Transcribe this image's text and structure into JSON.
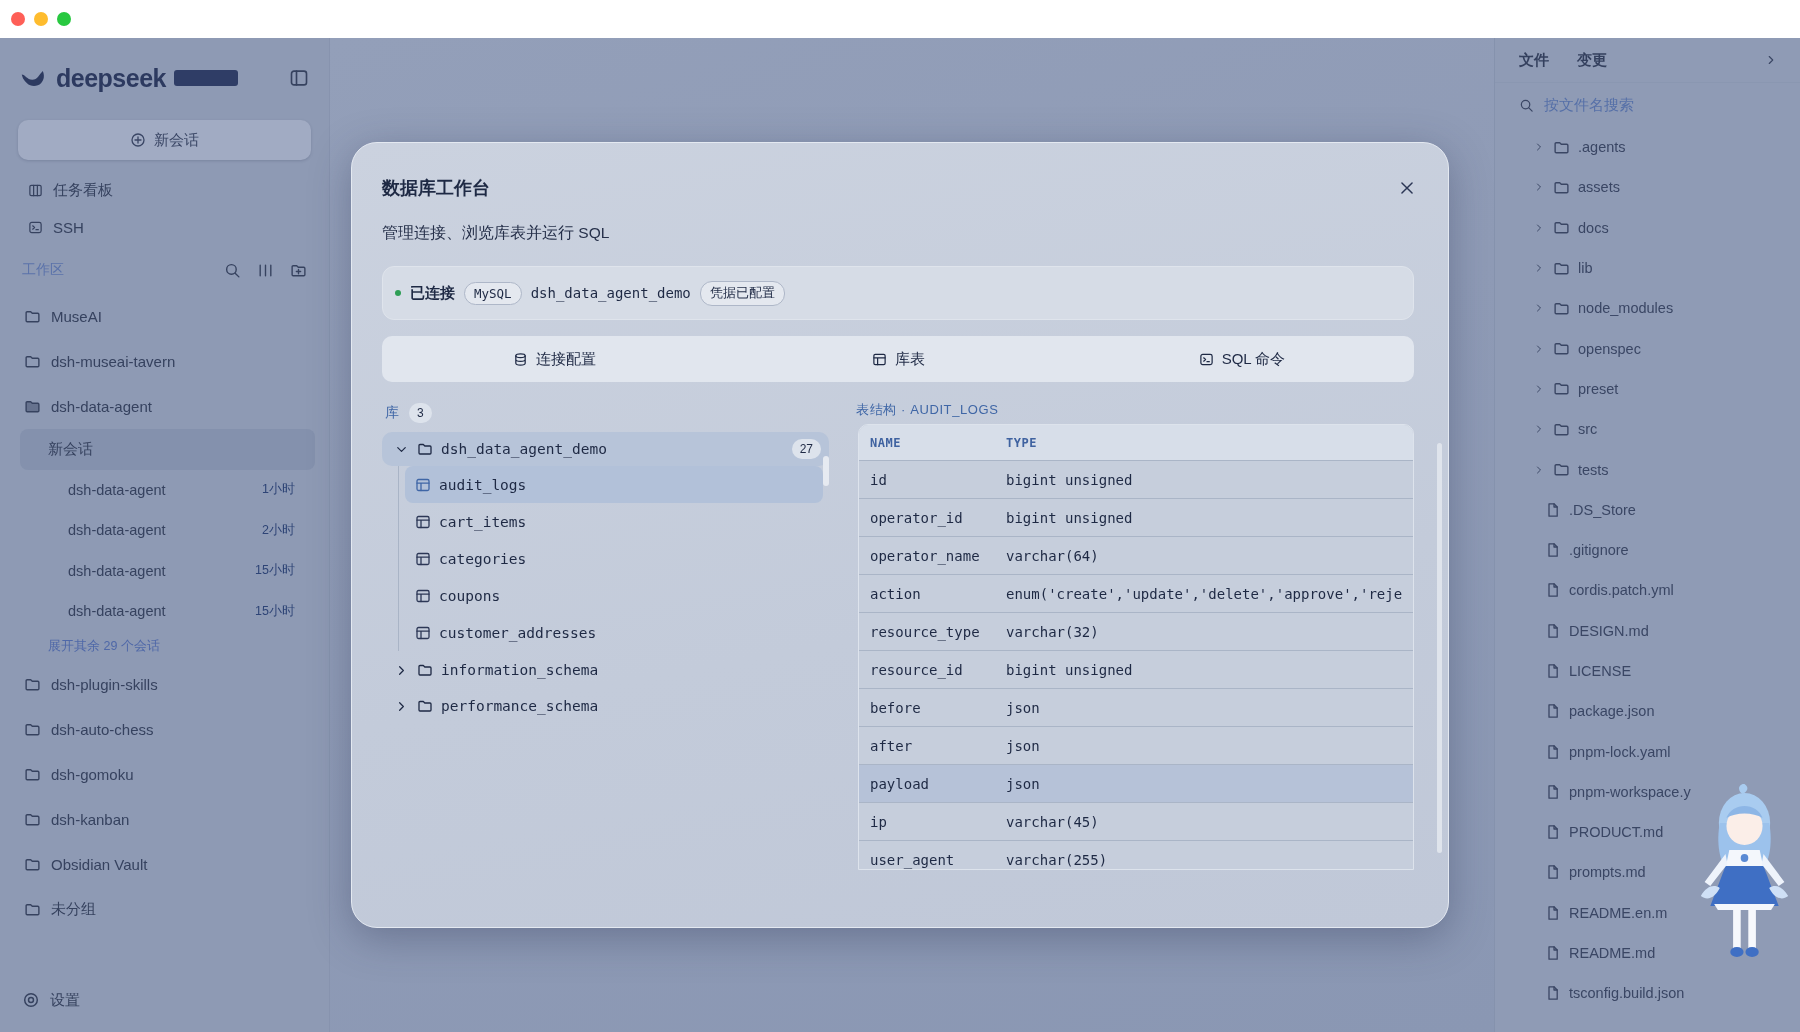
{
  "sidebar": {
    "brand": "deepseek",
    "new_chat": "新会话",
    "nav": [
      {
        "label": "任务看板",
        "kind": "board"
      },
      {
        "label": "SSH",
        "kind": "terminal"
      }
    ],
    "workspace_title": "工作区",
    "workspaces": [
      {
        "label": "MuseAI",
        "expanded": false
      },
      {
        "label": "dsh-museai-tavern",
        "expanded": false
      },
      {
        "label": "dsh-data-agent",
        "expanded": true,
        "children": [
          {
            "label": "新会话",
            "selected": true
          },
          {
            "label": "dsh-data-agent",
            "time": "1小时",
            "selected": false
          },
          {
            "label": "dsh-data-agent",
            "time": "2小时",
            "selected": false
          },
          {
            "label": "dsh-data-agent",
            "time": "15小时",
            "selected": false
          },
          {
            "label": "dsh-data-agent",
            "time": "15小时",
            "selected": false
          }
        ],
        "more": "展开其余 29 个会话"
      },
      {
        "label": "dsh-plugin-skills",
        "expanded": false
      },
      {
        "label": "dsh-auto-chess",
        "expanded": false
      },
      {
        "label": "dsh-gomoku",
        "expanded": false
      },
      {
        "label": "dsh-kanban",
        "expanded": false
      },
      {
        "label": "Obsidian Vault",
        "expanded": false
      },
      {
        "label": "未分组",
        "expanded": false
      }
    ],
    "settings": "设置"
  },
  "file_panel": {
    "tabs": [
      "文件",
      "变更"
    ],
    "search": {
      "placeholder": "按文件名搜索"
    },
    "items": [
      {
        "name": ".agents",
        "kind": "folder"
      },
      {
        "name": "assets",
        "kind": "folder"
      },
      {
        "name": "docs",
        "kind": "folder"
      },
      {
        "name": "lib",
        "kind": "folder"
      },
      {
        "name": "node_modules",
        "kind": "folder"
      },
      {
        "name": "openspec",
        "kind": "folder"
      },
      {
        "name": "preset",
        "kind": "folder"
      },
      {
        "name": "src",
        "kind": "folder"
      },
      {
        "name": "tests",
        "kind": "folder"
      },
      {
        "name": ".DS_Store",
        "kind": "file"
      },
      {
        "name": ".gitignore",
        "kind": "file"
      },
      {
        "name": "cordis.patch.yml",
        "kind": "file"
      },
      {
        "name": "DESIGN.md",
        "kind": "file"
      },
      {
        "name": "LICENSE",
        "kind": "file"
      },
      {
        "name": "package.json",
        "kind": "file"
      },
      {
        "name": "pnpm-lock.yaml",
        "kind": "file"
      },
      {
        "name": "pnpm-workspace.y",
        "kind": "file"
      },
      {
        "name": "PRODUCT.md",
        "kind": "file"
      },
      {
        "name": "prompts.md",
        "kind": "file"
      },
      {
        "name": "README.en.m",
        "kind": "file"
      },
      {
        "name": "README.md",
        "kind": "file"
      },
      {
        "name": "tsconfig.build.json",
        "kind": "file"
      }
    ]
  },
  "dialog": {
    "title": "数据库工作台",
    "subtitle": "管理连接、浏览库表并运行 SQL",
    "status": {
      "connected": true,
      "label": "已连接",
      "engine": "MySQL",
      "database": "dsh_data_agent_demo",
      "credentials": "凭据已配置"
    },
    "tabs": [
      {
        "label": "连接配置",
        "kind": "database"
      },
      {
        "label": "库表",
        "kind": "table"
      },
      {
        "label": "SQL 命令",
        "kind": "terminal"
      }
    ],
    "tree": {
      "title": "库",
      "count": "3",
      "databases": [
        {
          "name": "dsh_data_agent_demo",
          "count": "27",
          "expanded": true,
          "selected": true,
          "children": [
            {
              "name": "audit_logs",
              "selected": true
            },
            {
              "name": "cart_items",
              "selected": false
            },
            {
              "name": "categories",
              "selected": false
            },
            {
              "name": "coupons",
              "selected": false
            },
            {
              "name": "customer_addresses",
              "selected": false
            }
          ]
        },
        {
          "name": "information_schema",
          "expanded": false,
          "selected": false
        },
        {
          "name": "performance_schema",
          "expanded": false,
          "selected": false
        }
      ]
    },
    "schema": {
      "title": "表结构 · AUDIT_LOGS",
      "columns": [
        "NAME",
        "TYPE"
      ],
      "rows": [
        {
          "name": "id",
          "type": "bigint unsigned",
          "highlighted": false
        },
        {
          "name": "operator_id",
          "type": "bigint unsigned",
          "highlighted": false
        },
        {
          "name": "operator_name",
          "type": "varchar(64)",
          "highlighted": false
        },
        {
          "name": "action",
          "type": "enum('create','update','delete','approve','reje",
          "highlighted": false
        },
        {
          "name": "resource_type",
          "type": "varchar(32)",
          "highlighted": false
        },
        {
          "name": "resource_id",
          "type": "bigint unsigned",
          "highlighted": false
        },
        {
          "name": "before",
          "type": "json",
          "highlighted": false
        },
        {
          "name": "after",
          "type": "json",
          "highlighted": false
        },
        {
          "name": "payload",
          "type": "json",
          "highlighted": true
        },
        {
          "name": "ip",
          "type": "varchar(45)",
          "highlighted": false
        },
        {
          "name": "user_agent",
          "type": "varchar(255)",
          "highlighted": false
        }
      ]
    }
  }
}
